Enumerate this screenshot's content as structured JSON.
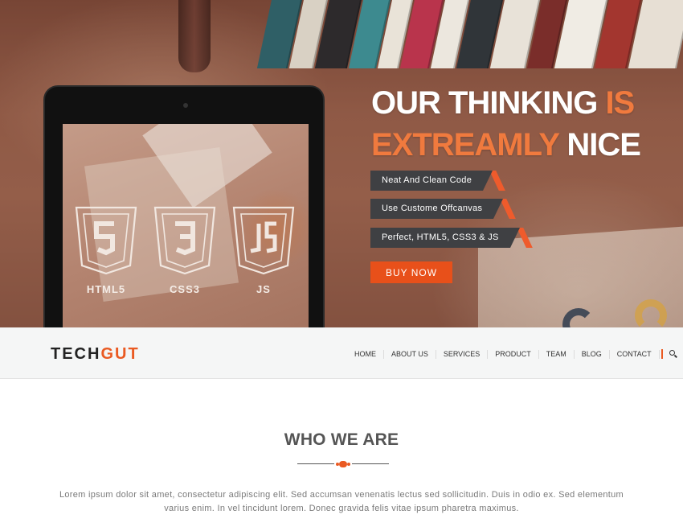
{
  "colors": {
    "accent": "#ea5a22",
    "hero_accent": "#f07a3e",
    "dark_label": "#3f4043",
    "navbar_bg": "#f5f6f6"
  },
  "hero": {
    "title_line1_a": "OUR THINKING ",
    "title_line1_b": "IS",
    "title_line2_a": "EXTREAMLY",
    "title_line2_b": " NICE",
    "features": [
      "Neat And Clean Code",
      "Use Custome Offcanvas",
      "Perfect, HTML5, CSS3 & JS"
    ],
    "buy_label": "BUY NOW",
    "tech_badges": [
      {
        "label": "HTML5",
        "icon": "html5-icon"
      },
      {
        "label": "CSS3",
        "icon": "css3-icon"
      },
      {
        "label": "JS",
        "icon": "js-icon"
      }
    ]
  },
  "navbar": {
    "logo_a": "TECH",
    "logo_b": "GUT",
    "items": [
      "HOME",
      "ABOUT US",
      "SERVICES",
      "PRODUCT",
      "TEAM",
      "BLOG",
      "CONTACT"
    ],
    "search_icon": "search-icon"
  },
  "about": {
    "title": "WHO WE ARE",
    "text": "Lorem ipsum dolor sit amet, consectetur adipiscing elit. Sed accumsan venenatis lectus sed sollicitudin. Duis in odio ex. Sed elementum varius enim. In vel tincidunt lorem. Donec gravida felis vitae ipsum pharetra maximus."
  }
}
